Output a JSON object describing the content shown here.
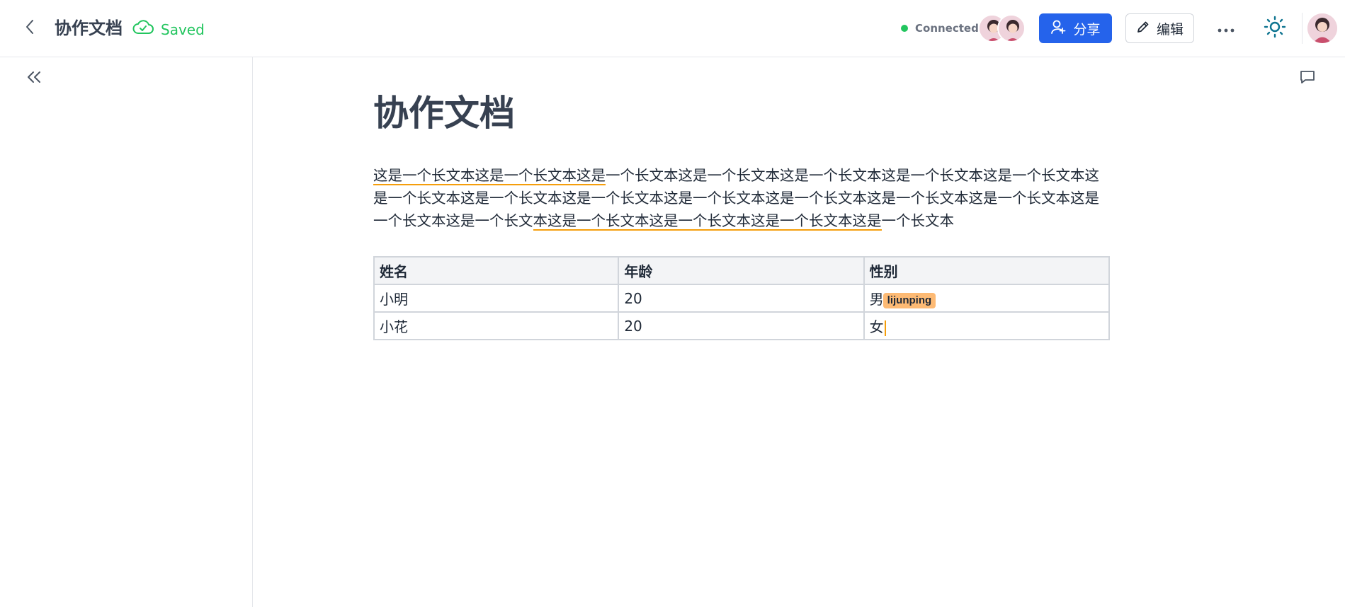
{
  "header": {
    "title": "协作文档",
    "saved_label": "Saved",
    "connection_status": "Connected",
    "share_label": "分享",
    "edit_label": "编辑"
  },
  "document": {
    "title": "协作文档",
    "paragraph_parts": [
      "这是一个长文本这是一个长文本这是",
      "一个长文本这是一个长文本这是一个长文本这是一个长文本这是一个长文本这是一个长文本这是一个长文本这是一个长文本这是一个长文本这是一个长文本这是一个长文本这是一个长文本这是一个长文本这是一个长文",
      "本这是一个长文本这是一个长文本这是一个长文本这是",
      "一个长文本"
    ],
    "table": {
      "headers": [
        "姓名",
        "年龄",
        "性别"
      ],
      "rows": [
        [
          "小明",
          "20",
          "男"
        ],
        [
          "小花",
          "20",
          "女"
        ]
      ]
    },
    "collaborator_cursor": "lijunping"
  },
  "colors": {
    "primary": "#2563eb",
    "success": "#22c55e",
    "highlight": "#f59e0b",
    "collaborator": "#fdba74"
  }
}
